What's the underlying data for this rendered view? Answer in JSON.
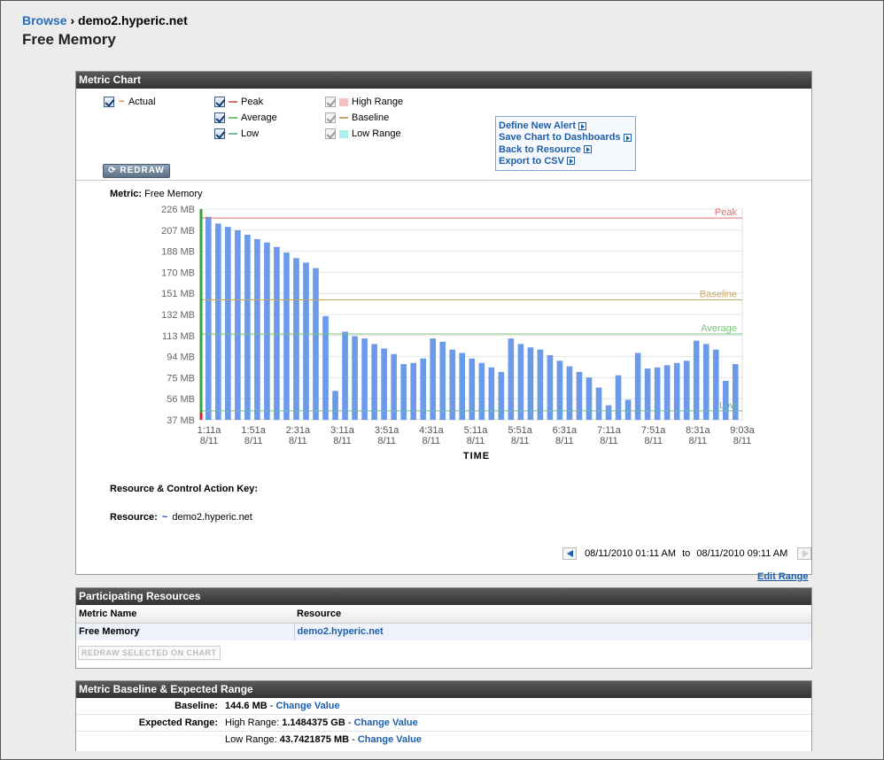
{
  "breadcrumb": {
    "browse": "Browse",
    "separator": "›",
    "resource": "demo2.hyperic.net"
  },
  "page_title": "Free Memory",
  "metric_chart": {
    "header": "Metric Chart",
    "legend": {
      "actual": "Actual",
      "peak": "Peak",
      "average": "Average",
      "low": "Low",
      "high_range": "High Range",
      "baseline": "Baseline",
      "low_range": "Low Range"
    },
    "redraw_label": "REDRAW",
    "links": [
      "Define New Alert",
      "Save Chart to Dashboards",
      "Back to Resource",
      "Export to CSV"
    ],
    "metric_prefix": "Metric:",
    "metric_name": "Free Memory",
    "key_title": "Resource & Control Action Key:",
    "resource_prefix": "Resource:",
    "resource_name": "demo2.hyperic.net",
    "range_from": "08/11/2010 01:11 AM",
    "range_to_word": "to",
    "range_to": "08/11/2010 09:11 AM",
    "edit_range": "Edit Range"
  },
  "colors": {
    "bar": "#6b9be8",
    "peak": "#e07070",
    "baseline": "#c8a868",
    "average": "#7bc07b",
    "low": "#70b8a0",
    "high_range": "#f4c0c0",
    "low_range": "#b0eeee",
    "link": "#1f5ea8"
  },
  "chart_data": {
    "type": "bar",
    "title": "",
    "xlabel": "TIME",
    "ylabel": "",
    "ylim": [
      37,
      226
    ],
    "y_ticks": [
      "226 MB",
      "207 MB",
      "188 MB",
      "170 MB",
      "151 MB",
      "132 MB",
      "113 MB",
      "94 MB",
      "75 MB",
      "56 MB",
      "37 MB"
    ],
    "x_ticks": [
      [
        "1:11a",
        "8/11"
      ],
      [
        "1:51a",
        "8/11"
      ],
      [
        "2:31a",
        "8/11"
      ],
      [
        "3:11a",
        "8/11"
      ],
      [
        "3:51a",
        "8/11"
      ],
      [
        "4:31a",
        "8/11"
      ],
      [
        "5:11a",
        "8/11"
      ],
      [
        "5:51a",
        "8/11"
      ],
      [
        "6:31a",
        "8/11"
      ],
      [
        "7:11a",
        "8/11"
      ],
      [
        "7:51a",
        "8/11"
      ],
      [
        "8:31a",
        "8/11"
      ],
      [
        "9:03a",
        "8/11"
      ]
    ],
    "series": [
      {
        "name": "Actual",
        "values": [
          219,
          213,
          210,
          207,
          203,
          199,
          196,
          192,
          187,
          182,
          178,
          173,
          130,
          63,
          116,
          112,
          110,
          105,
          101,
          96,
          87,
          88,
          92,
          110,
          107,
          100,
          97,
          92,
          88,
          84,
          80,
          110,
          105,
          102,
          100,
          95,
          90,
          85,
          80,
          75,
          66,
          50,
          77,
          55,
          97,
          83,
          84,
          86,
          88,
          90,
          108,
          105,
          100,
          72,
          87
        ]
      }
    ],
    "reference_lines": [
      {
        "name": "Peak",
        "value": 218
      },
      {
        "name": "Baseline",
        "value": 144.6
      },
      {
        "name": "Average",
        "value": 114
      },
      {
        "name": "Low",
        "value": 45
      }
    ],
    "legend_placement": "top-left",
    "grid": true
  },
  "participating": {
    "header": "Participating Resources",
    "col_metric": "Metric Name",
    "col_resource": "Resource",
    "row_metric": "Free Memory",
    "row_resource": "demo2.hyperic.net",
    "redraw_selected": "REDRAW SELECTED ON CHART"
  },
  "baseline_section": {
    "header": "Metric Baseline & Expected Range",
    "baseline_label": "Baseline:",
    "baseline_value": "144.6 MB",
    "expected_label": "Expected Range:",
    "high_prefix": "High Range:",
    "high_value": "1.1484375 GB",
    "low_prefix": "Low Range:",
    "low_value": "43.7421875 MB",
    "dash": "-",
    "change_value": "Change Value"
  }
}
